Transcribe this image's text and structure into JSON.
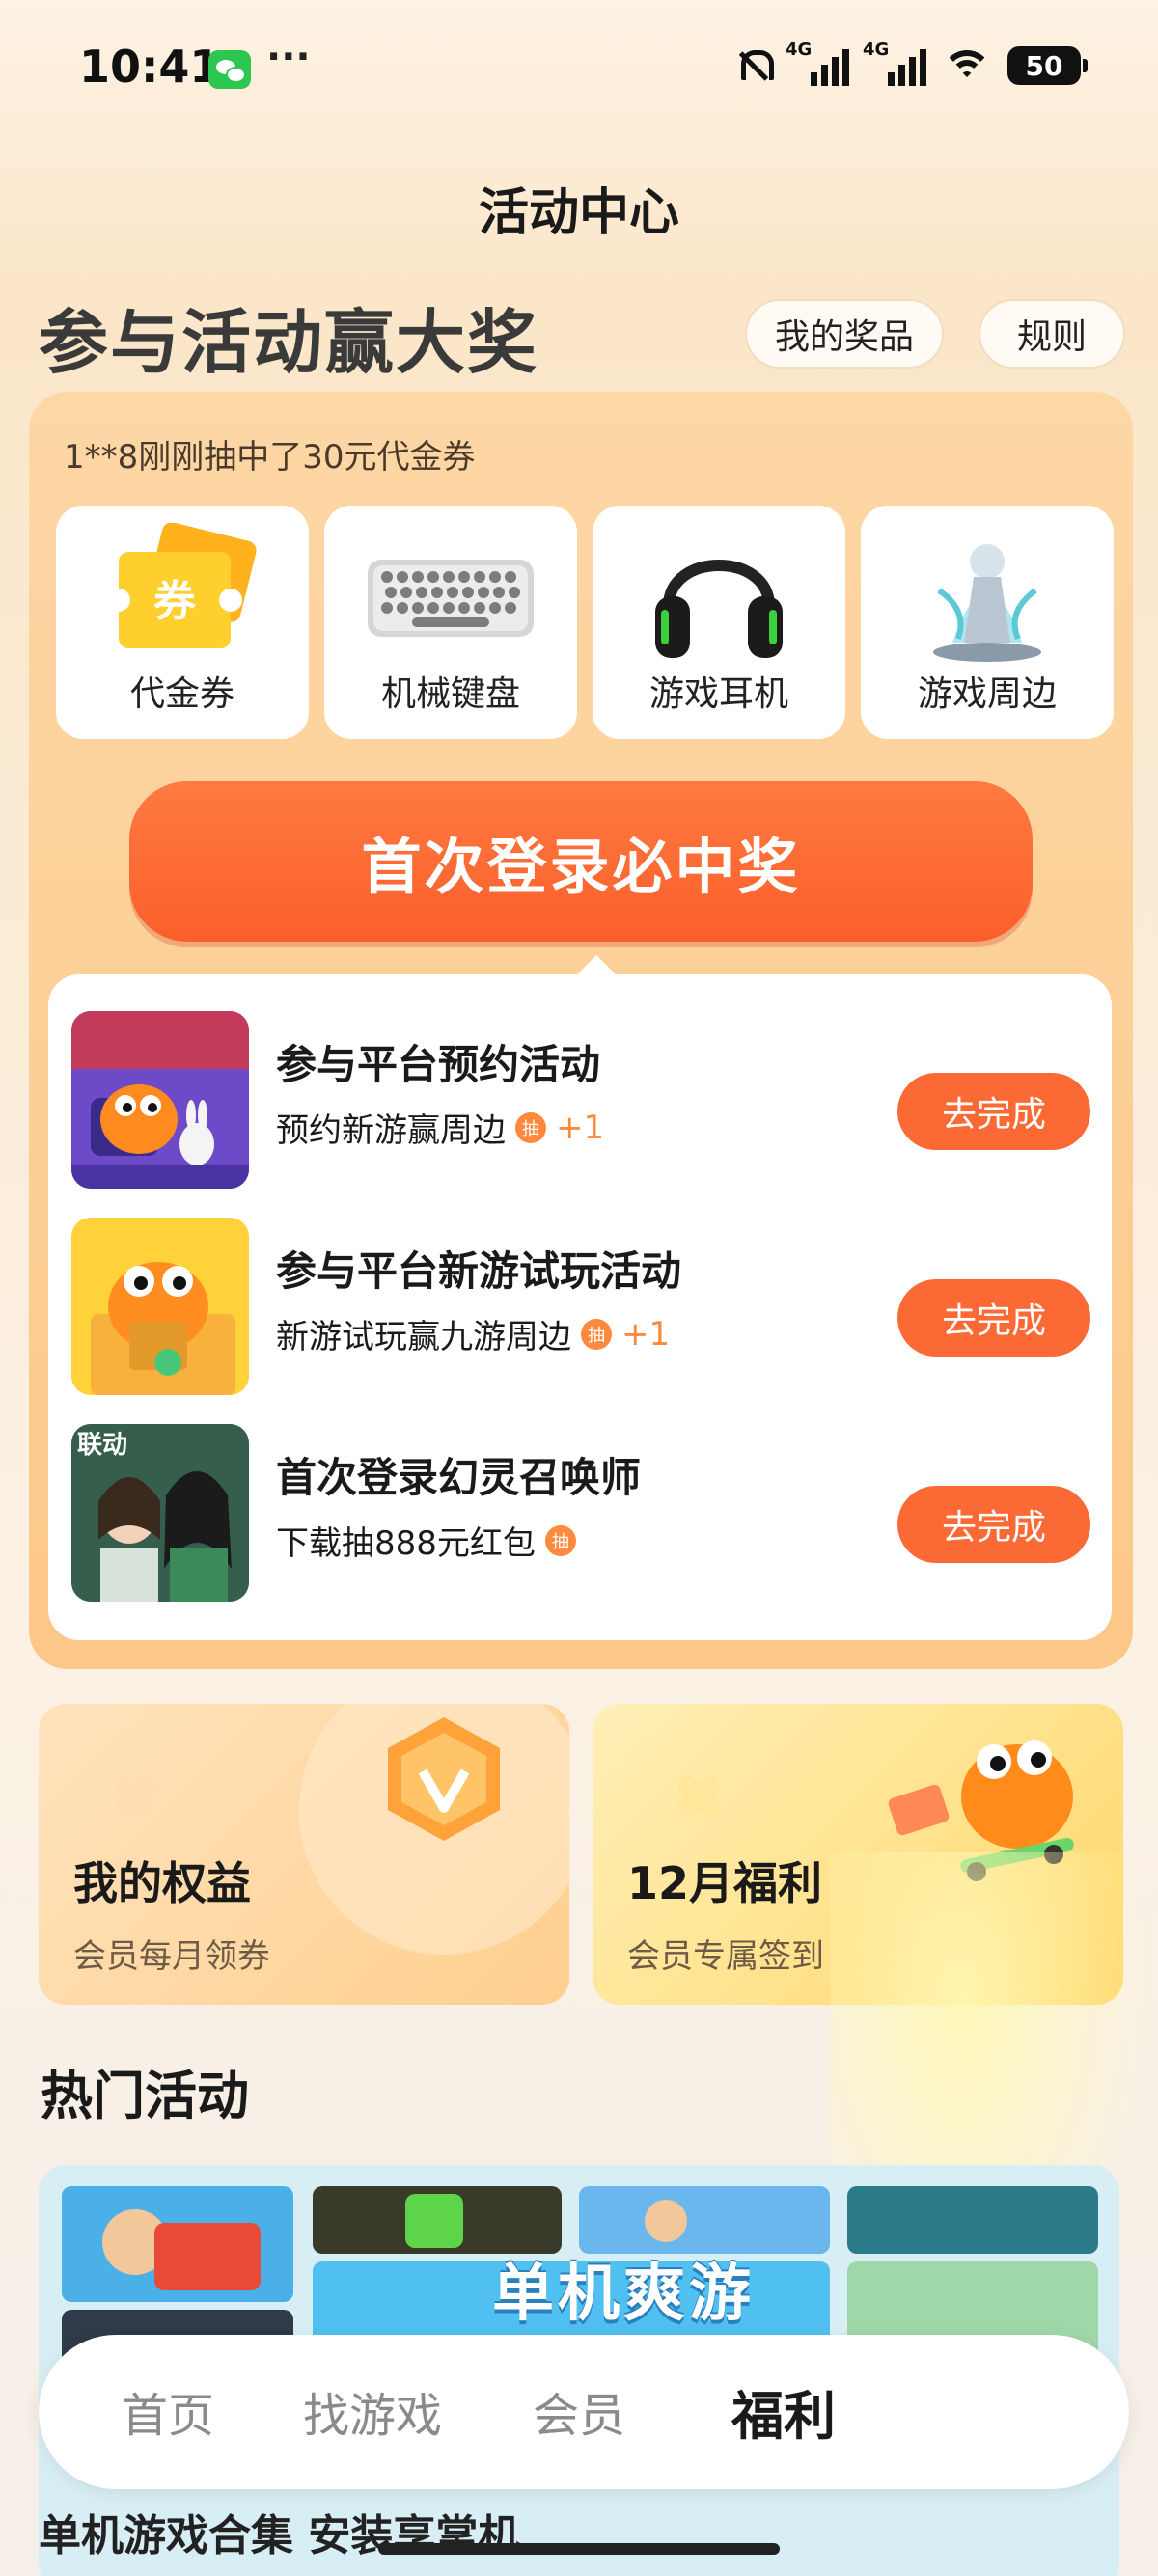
{
  "status_bar": {
    "time": "10:41",
    "more": "···",
    "signal_1": "4G",
    "signal_2": "4G",
    "battery": "50"
  },
  "page_title": "活动中心",
  "headline": "参与活动赢大奖",
  "header_buttons": {
    "my_prizes": "我的奖品",
    "rules": "规则"
  },
  "ticker": "1**8刚刚抽中了30元代金券",
  "prizes": [
    {
      "label": "代金券",
      "icon": "voucher-icon",
      "badge": "券"
    },
    {
      "label": "机械键盘",
      "icon": "keyboard-icon"
    },
    {
      "label": "游戏耳机",
      "icon": "headphones-icon"
    },
    {
      "label": "游戏周边",
      "icon": "figure-icon"
    }
  ],
  "cta": "首次登录必中奖",
  "tasks": [
    {
      "title": "参与平台预约活动",
      "subtitle": "预约新游赢周边",
      "lottery_badge": "抽",
      "extra": "+1",
      "button": "去完成"
    },
    {
      "title": "参与平台新游试玩活动",
      "subtitle": "新游试玩赢九游周边",
      "lottery_badge": "抽",
      "extra": "+1",
      "button": "去完成"
    },
    {
      "title": "首次登录幻灵召唤师",
      "subtitle": "下载抽888元红包",
      "lottery_badge": "抽",
      "thumb_tag": "联动",
      "button": "去完成"
    }
  ],
  "promos": [
    {
      "title": "我的权益",
      "subtitle": "会员每月领券"
    },
    {
      "title": "12月福利",
      "subtitle": "会员专属签到"
    }
  ],
  "hot_section_title": "热门活动",
  "banner": {
    "text": "单机爽游",
    "caption": "单机游戏合集 安装享掌机"
  },
  "tabbar": {
    "tabs": [
      {
        "label": "首页"
      },
      {
        "label": "找游戏"
      },
      {
        "label": "会员"
      },
      {
        "label": "福利"
      }
    ],
    "active": "福利"
  },
  "colors": {
    "accent": "#fb6a35",
    "card_bg": "#fdd7a6",
    "lottery": "#ff8a3d"
  }
}
